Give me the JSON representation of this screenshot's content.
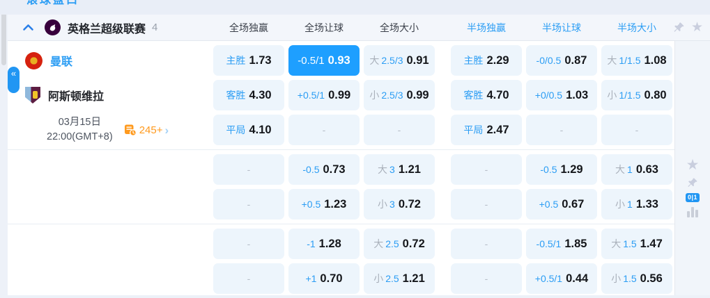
{
  "palette": {
    "accent_blue": "#2b9df4",
    "selected_cell_blue": "#1e9fff",
    "cell_background": "#edf5fc",
    "orange": "#ff9a1e",
    "muted_gray": "#a9b0ba"
  },
  "top_bar": {
    "clipped_tab": "滚球盘口"
  },
  "league": {
    "name": "英格兰超级联赛",
    "match_count": "4",
    "columns": [
      "全场独赢",
      "全场让球",
      "全场大小",
      "半场独赢",
      "半场让球",
      "半场大小"
    ]
  },
  "match": {
    "home_team": "曼联",
    "away_team": "阿斯顿维拉",
    "date": "03月15日",
    "time": "22:00(GMT+8)",
    "more_markets_count": "245+"
  },
  "odds": {
    "b1": [
      [
        {
          "l": "主胜",
          "v": "1.73"
        },
        {
          "l": "-0.5/1",
          "v": "0.93",
          "selected": true
        },
        {
          "g": "大",
          "l": "2.5/3",
          "v": "0.91"
        },
        {
          "l": "主胜",
          "v": "2.29"
        },
        {
          "l": "-0/0.5",
          "v": "0.87"
        },
        {
          "g": "大",
          "l": "1/1.5",
          "v": "1.08"
        }
      ],
      [
        {
          "l": "客胜",
          "v": "4.30"
        },
        {
          "l": "+0.5/1",
          "v": "0.99"
        },
        {
          "g": "小",
          "l": "2.5/3",
          "v": "0.99"
        },
        {
          "l": "客胜",
          "v": "4.70"
        },
        {
          "l": "+0/0.5",
          "v": "1.03"
        },
        {
          "g": "小",
          "l": "1/1.5",
          "v": "0.80"
        }
      ],
      [
        {
          "l": "平局",
          "v": "4.10"
        },
        {
          "v": "-"
        },
        {
          "v": "-"
        },
        {
          "l": "平局",
          "v": "2.47"
        },
        {
          "v": "-"
        },
        {
          "v": "-"
        }
      ]
    ],
    "b2": [
      [
        {
          "v": "-"
        },
        {
          "l": "-0.5",
          "v": "0.73"
        },
        {
          "g": "大",
          "l": "3",
          "v": "1.21"
        },
        {
          "v": "-"
        },
        {
          "l": "-0.5",
          "v": "1.29"
        },
        {
          "g": "大",
          "l": "1",
          "v": "0.63"
        }
      ],
      [
        {
          "v": "-"
        },
        {
          "l": "+0.5",
          "v": "1.23"
        },
        {
          "g": "小",
          "l": "3",
          "v": "0.72"
        },
        {
          "v": "-"
        },
        {
          "l": "+0.5",
          "v": "0.67"
        },
        {
          "g": "小",
          "l": "1",
          "v": "1.33"
        }
      ]
    ],
    "b3": [
      [
        {
          "v": "-"
        },
        {
          "l": "-1",
          "v": "1.28"
        },
        {
          "g": "大",
          "l": "2.5",
          "v": "0.72"
        },
        {
          "v": "-"
        },
        {
          "l": "-0.5/1",
          "v": "1.85"
        },
        {
          "g": "大",
          "l": "1.5",
          "v": "1.47"
        }
      ],
      [
        {
          "v": "-"
        },
        {
          "l": "+1",
          "v": "0.70"
        },
        {
          "g": "小",
          "l": "2.5",
          "v": "1.21"
        },
        {
          "v": "-"
        },
        {
          "l": "+0.5/1",
          "v": "0.44"
        },
        {
          "g": "小",
          "l": "1.5",
          "v": "0.56"
        }
      ]
    ]
  },
  "icons": {
    "collapse": "«",
    "more_chevron": "›",
    "star": "★",
    "count_badge": "0|1"
  }
}
